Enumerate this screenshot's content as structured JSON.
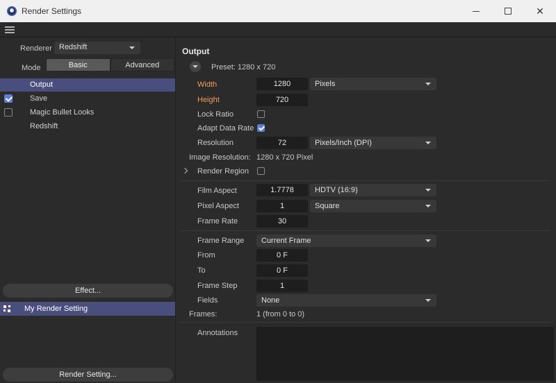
{
  "window": {
    "title": "Render Settings"
  },
  "left": {
    "renderer_label": "Renderer",
    "renderer_value": "Redshift",
    "mode_label": "Mode",
    "mode_tabs": [
      "Basic",
      "Advanced"
    ],
    "items": [
      {
        "label": "Output",
        "checkbox": null
      },
      {
        "label": "Save",
        "checkbox": true
      },
      {
        "label": "Magic Bullet Looks",
        "checkbox": false
      },
      {
        "label": "Redshift",
        "checkbox": null
      }
    ],
    "effect_button": "Effect...",
    "render_setting_name": "My Render Setting",
    "render_setting_button": "Render Setting..."
  },
  "output": {
    "title": "Output",
    "preset": "Preset: 1280 x 720",
    "width_label": "Width",
    "width_value": "1280",
    "width_unit": "Pixels",
    "height_label": "Height",
    "height_value": "720",
    "lock_ratio_label": "Lock Ratio",
    "adapt_label": "Adapt Data Rate",
    "resolution_label": "Resolution",
    "resolution_value": "72",
    "resolution_unit": "Pixels/Inch (DPI)",
    "image_res_label": "Image Resolution:",
    "image_res_value": "1280 x 720 Pixel",
    "render_region_label": "Render Region",
    "film_aspect_label": "Film Aspect",
    "film_aspect_value": "1.7778",
    "film_aspect_preset": "HDTV (16:9)",
    "pixel_aspect_label": "Pixel Aspect",
    "pixel_aspect_value": "1",
    "pixel_aspect_preset": "Square",
    "frame_rate_label": "Frame Rate",
    "frame_rate_value": "30",
    "frame_range_label": "Frame Range",
    "frame_range_value": "Current Frame",
    "from_label": "From",
    "from_value": "0 F",
    "to_label": "To",
    "to_value": "0 F",
    "frame_step_label": "Frame Step",
    "frame_step_value": "1",
    "fields_label": "Fields",
    "fields_value": "None",
    "frames_label": "Frames:",
    "frames_value": "1 (from 0 to 0)",
    "annotations_label": "Annotations"
  }
}
